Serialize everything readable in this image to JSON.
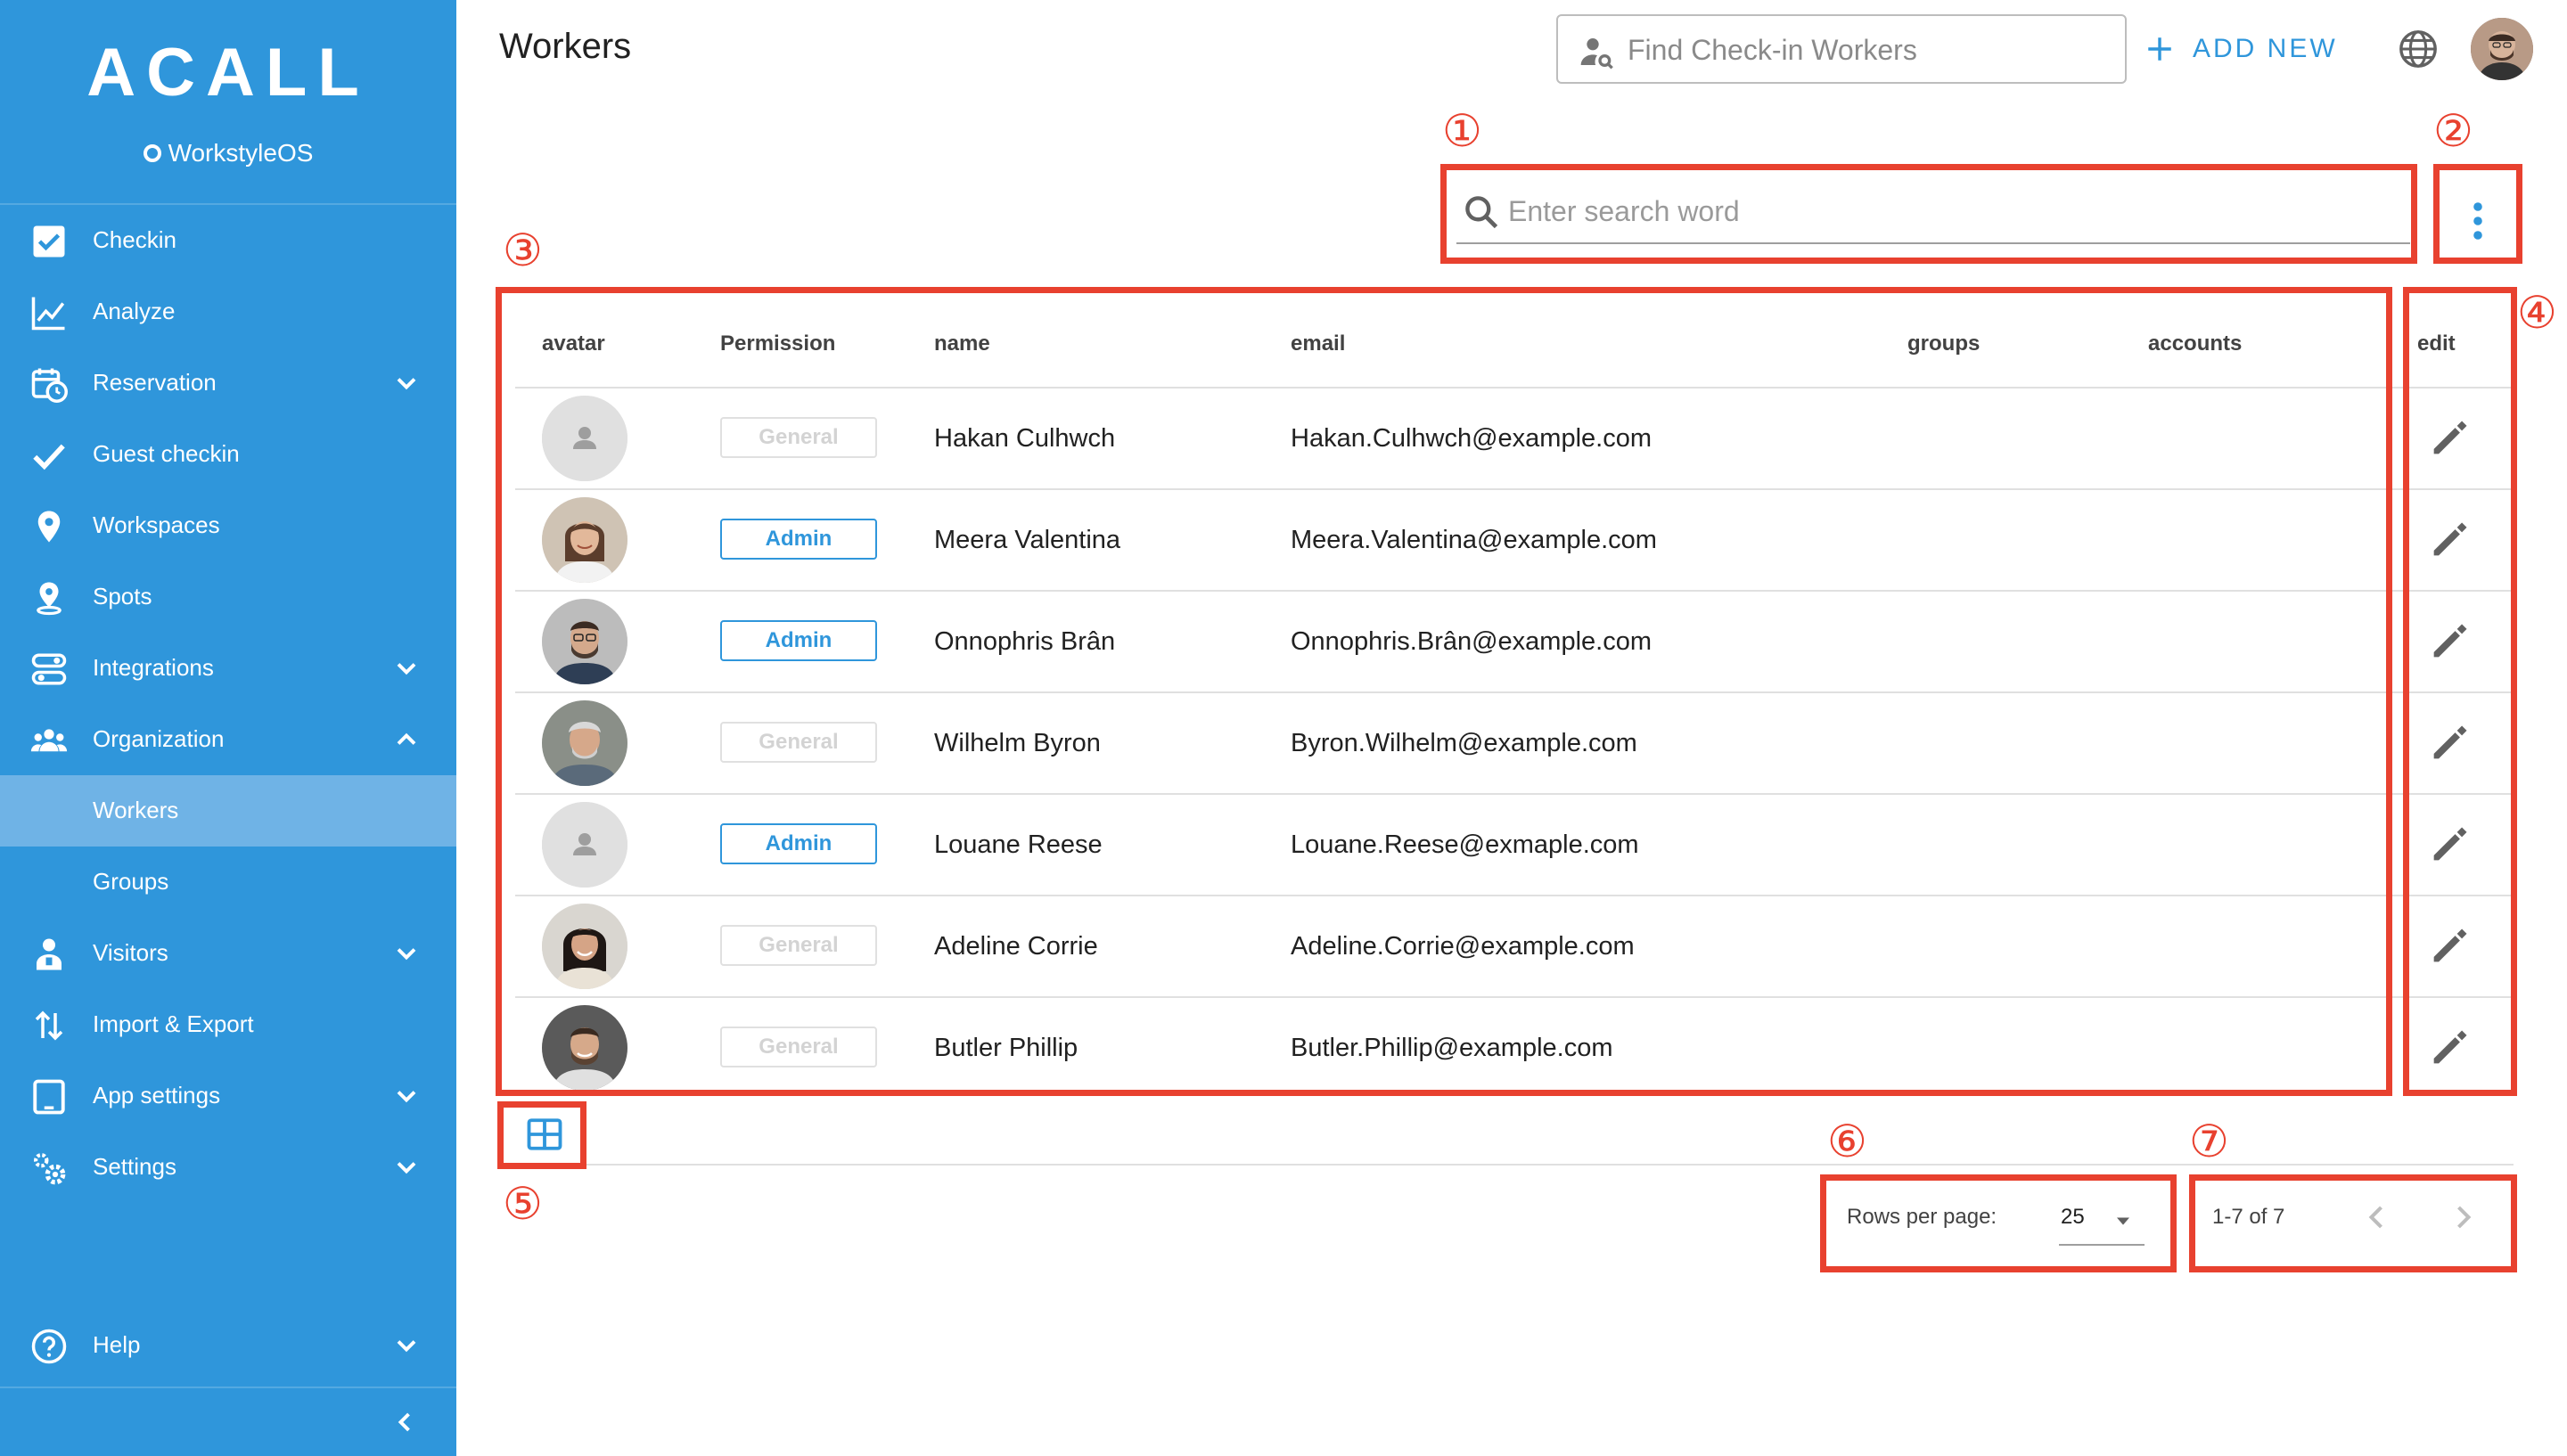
{
  "sidebar": {
    "logo": "ACALL",
    "sublogo": "WorkstyleOS",
    "items": [
      {
        "label": "Checkin",
        "icon": "checkbox-icon"
      },
      {
        "label": "Analyze",
        "icon": "line-chart-icon"
      },
      {
        "label": "Reservation",
        "icon": "calendar-clock-icon",
        "expand": "down"
      },
      {
        "label": "Guest checkin",
        "icon": "checkmark-icon"
      },
      {
        "label": "Workspaces",
        "icon": "map-pin-icon"
      },
      {
        "label": "Spots",
        "icon": "location-pin-icon"
      },
      {
        "label": "Integrations",
        "icon": "integrations-icon",
        "expand": "down"
      },
      {
        "label": "Organization",
        "icon": "people-icon",
        "expand": "up"
      },
      {
        "label": "Workers",
        "active": true
      },
      {
        "label": "Groups"
      },
      {
        "label": "Visitors",
        "icon": "visitor-icon",
        "expand": "down"
      },
      {
        "label": "Import & Export",
        "icon": "import-export-icon"
      },
      {
        "label": "App settings",
        "icon": "tablet-icon",
        "expand": "down"
      },
      {
        "label": "Settings",
        "icon": "gears-icon",
        "expand": "down"
      },
      {
        "label": "Help",
        "icon": "help-icon",
        "expand": "down"
      }
    ]
  },
  "header": {
    "title": "Workers",
    "find_placeholder": "Find Check-in Workers",
    "add_new_label": "ADD NEW"
  },
  "search": {
    "placeholder": "Enter search word"
  },
  "annotations": [
    "①",
    "②",
    "③",
    "④",
    "⑤",
    "⑥",
    "⑦"
  ],
  "table": {
    "columns": [
      "avatar",
      "Permission",
      "name",
      "email",
      "groups",
      "accounts",
      "edit"
    ],
    "rows": [
      {
        "permission": "General",
        "name": "Hakan Culhwch",
        "email": "Hakan.Culhwch@example.com",
        "avatar": "placeholder"
      },
      {
        "permission": "Admin",
        "name": "Meera Valentina",
        "email": "Meera.Valentina@example.com",
        "avatar": "photo"
      },
      {
        "permission": "Admin",
        "name": "Onnophris Brân",
        "email": "Onnophris.Brân@example.com",
        "avatar": "photo"
      },
      {
        "permission": "General",
        "name": "Wilhelm Byron",
        "email": "Byron.Wilhelm@example.com",
        "avatar": "photo"
      },
      {
        "permission": "Admin",
        "name": "Louane Reese",
        "email": "Louane.Reese@exmaple.com",
        "avatar": "placeholder"
      },
      {
        "permission": "General",
        "name": "Adeline Corrie",
        "email": "Adeline.Corrie@example.com",
        "avatar": "photo"
      },
      {
        "permission": "General",
        "name": "Butler Phillip",
        "email": "Butler.Phillip@example.com",
        "avatar": "photo"
      }
    ]
  },
  "pagination": {
    "rows_per_page_label": "Rows per page:",
    "rows_per_page": "25",
    "range": "1-7 of 7"
  },
  "colors": {
    "sidebar": "#2f96db",
    "sidebar_active": "#6fb3e6",
    "accent": "#2f96db",
    "annotation": "#e8412f"
  }
}
